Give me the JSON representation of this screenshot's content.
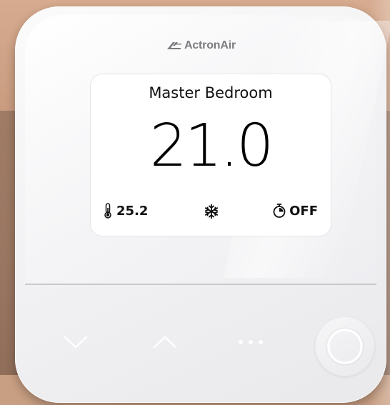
{
  "device": {
    "brand": "ActronAir",
    "zone_name": "Master Bedroom",
    "setpoint": "21.0",
    "room_temperature": "25.2",
    "mode_icon": "snowflake-icon",
    "timer_status": "OFF"
  },
  "icons": {
    "room_temp": "thermometer-icon",
    "timer": "stopwatch-icon",
    "down": "chevron-down-icon",
    "up": "chevron-up-icon",
    "more": "more-dots-icon",
    "power": "circle-button-icon"
  },
  "colors": {
    "device_body": "#f2f2f4",
    "screen": "#ffffff",
    "text": "#000000",
    "brand_text": "#7c7c80",
    "wall_top": "#d6ab8f",
    "wall_mid": "#9a7762"
  }
}
